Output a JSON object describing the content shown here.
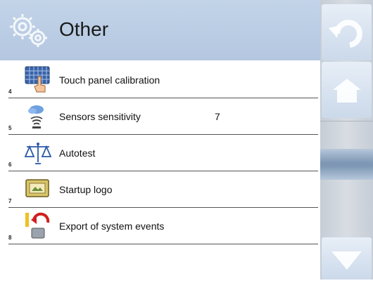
{
  "header": {
    "title": "Other",
    "icon": "gears-icon"
  },
  "rows": [
    {
      "number": "4",
      "label": "Touch panel calibration",
      "value": "",
      "icon": "touch-calibration-icon"
    },
    {
      "number": "5",
      "label": "Sensors sensitivity",
      "value": "7",
      "icon": "sensor-icon"
    },
    {
      "number": "6",
      "label": "Autotest",
      "value": "",
      "icon": "scale-balance-icon"
    },
    {
      "number": "7",
      "label": "Startup logo",
      "value": "",
      "icon": "logo-picture-icon"
    },
    {
      "number": "8",
      "label": "Export of system events",
      "value": "",
      "icon": "export-events-icon"
    }
  ],
  "sidebar": {
    "back_icon": "undo-arrow-icon",
    "home_icon": "home-icon",
    "scroll_icon": "scrollbar-thumb",
    "down_icon": "arrow-down-icon"
  },
  "colors": {
    "header_bg": "#bccde4",
    "accent": "#7d97b4"
  }
}
